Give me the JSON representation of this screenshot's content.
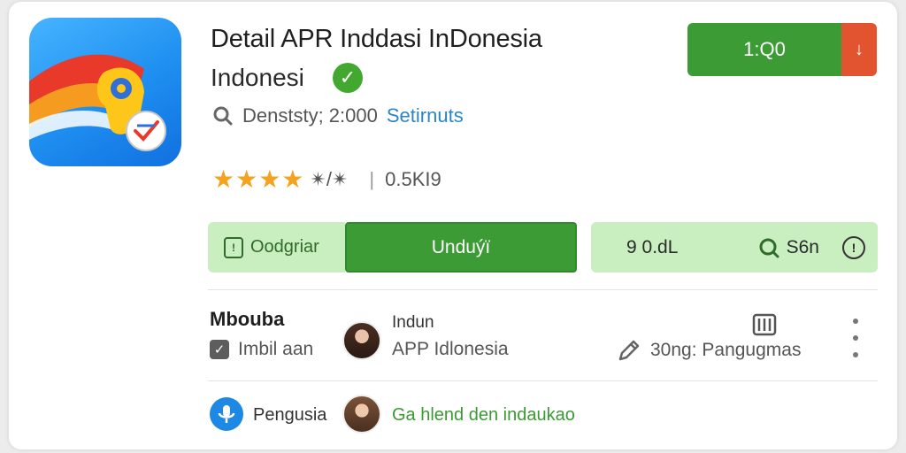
{
  "app": {
    "title": "Detail APR Inddasi InDonesia",
    "subtitle": "Indonesi",
    "developer_label": "Denststy; 2:000",
    "developer_link": "Setirnuts",
    "stars": "★★★★",
    "rating_value": "✴/✴",
    "downloads": "0.5KI9",
    "icon": "app-logo-icon",
    "verified_icon": "check-badge-icon"
  },
  "header_actions": {
    "install_label": "1:Q0",
    "download_symbol": "↓"
  },
  "action_bar": {
    "left_label": "Oodgriar",
    "main_label": "Unduýї",
    "size_label": "9 0.dL",
    "age_label": "S6n",
    "info_symbol": "!"
  },
  "details": {
    "section_title": "Mbouba",
    "check_label": "Imbil aan",
    "author_name": "Indun",
    "author_app": "APP Idlonesia",
    "report_label": "30ng: Pangugmas"
  },
  "footer": {
    "lang_label": "Pengusia",
    "promo_text": "Ga hlend den indaukao"
  },
  "colors": {
    "primary_green": "#3d9b35",
    "light_green": "#c9eebf",
    "accent_orange": "#e2542f",
    "star": "#f3a31e",
    "link_blue": "#2a86c9",
    "mic_blue": "#1e88e5"
  }
}
